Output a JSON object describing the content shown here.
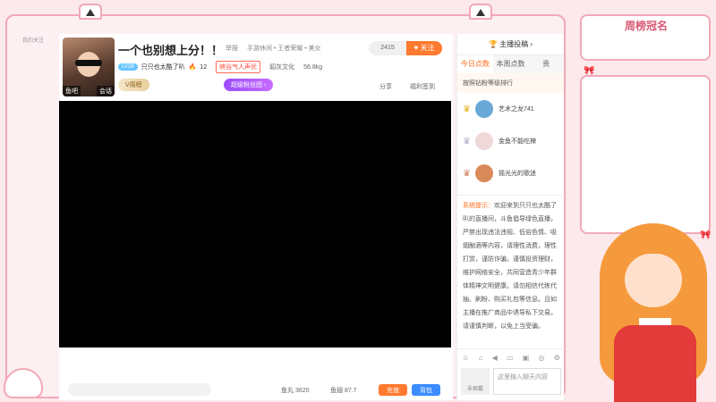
{
  "overlay": {
    "weekly_title": "周榜冠名"
  },
  "left_strip": {
    "label": "我的关注"
  },
  "room": {
    "title": "一个也别想上分！！",
    "meta": [
      "举报",
      "手游休闲 • 王者荣耀 • 美女"
    ],
    "followers": "2415",
    "follow_label": "关注",
    "level": "LV28",
    "anchor_name": "只只也太酷了叭",
    "hot_value": "12",
    "hot_badge": "峡谷气人声优",
    "guild": "貂灰文化",
    "weight": "56.8kg",
    "avatar_tags": [
      "鱼吧",
      "会话"
    ],
    "vip_label": "V周榜",
    "fanclub_label": "超级粉丝团 ›",
    "share_label": "分享",
    "checkin_label": "福利签到",
    "bottom": {
      "fishball": "鱼丸 3620",
      "fishfin": "鱼翅 87.7",
      "recharge": "充值",
      "backpack": "背包"
    }
  },
  "side": {
    "header": "主播投稿 ›",
    "tabs": [
      "今日点数",
      "本周点数",
      "贵"
    ],
    "rank_title": "按照钻粉等级排行",
    "ranks": [
      {
        "name": "艺术之龙741",
        "color": "#6aa8d8",
        "crown": "#e8b420"
      },
      {
        "name": "金鱼不能吃辣",
        "color": "#f0d8d8",
        "crown": "#b0b0c8"
      },
      {
        "name": "摇光光的歌迷",
        "color": "#d88a5a",
        "crown": "#d08060"
      }
    ],
    "chat_prefix": "系统提示：",
    "chat_text": "欢迎来到只只也太酷了叭的直播间，斗鱼倡导绿色直播，严禁出现违法违规、低俗色情、吸烟酗酒等内容，请理性消费，理性打赏，谨防诈骗，谨慎投资理财，维护网络安全，共同营造青少年群体精神文明健康。请勿相信代练代抽、刷粉、购买礼包等信息。且如主播在推广商品中诱导私下交易，请谨慎判断，以免上当受骗。",
    "uncert_label": "未佩戴",
    "chat_placeholder": "这里输入聊天内容"
  }
}
